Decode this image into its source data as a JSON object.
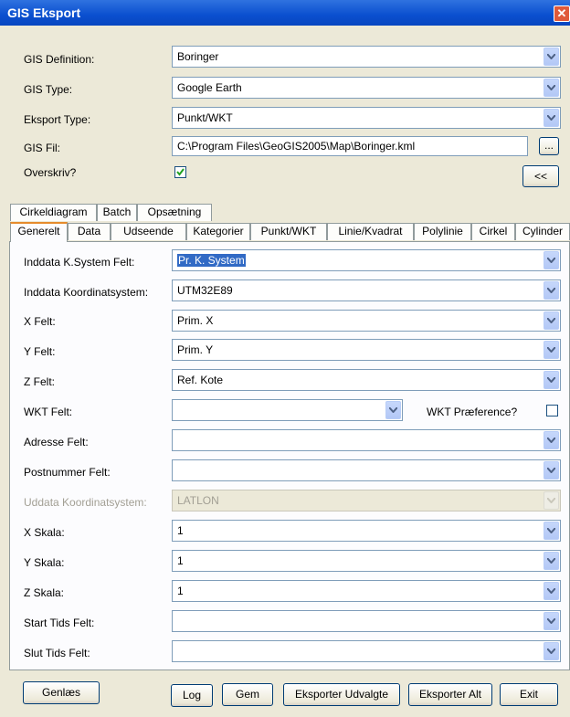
{
  "window": {
    "title": "GIS Eksport"
  },
  "top": {
    "definition_label": "GIS Definition:",
    "definition_value": "Boringer",
    "type_label": "GIS Type:",
    "type_value": "Google Earth",
    "export_type_label": "Eksport Type:",
    "export_type_value": "Punkt/WKT",
    "file_label": "GIS Fil:",
    "file_value": "C:\\Program Files\\GeoGIS2005\\Map\\Boringer.kml",
    "browse_label": "...",
    "overwrite_label": "Overskriv?",
    "overwrite_checked": true,
    "collapse_label": "<<"
  },
  "tabs_row1": [
    "Cirkeldiagram",
    "Batch",
    "Opsætning"
  ],
  "tabs_row2": [
    "Generelt",
    "Data",
    "Udseende",
    "Kategorier",
    "Punkt/WKT",
    "Linie/Kvadrat",
    "Polylinie",
    "Cirkel",
    "Cylinder"
  ],
  "fields": {
    "ks_label": "Inddata K.System Felt:",
    "ks_value": "Pr. K. System",
    "coord_label": "Inddata Koordinatsystem:",
    "coord_value": "UTM32E89",
    "x_label": "X Felt:",
    "x_value": "Prim. X",
    "y_label": "Y Felt:",
    "y_value": "Prim. Y",
    "z_label": "Z Felt:",
    "z_value": "Ref. Kote",
    "wkt_label": "WKT Felt:",
    "wkt_value": "",
    "wkt_pref_label": "WKT Præference?",
    "address_label": "Adresse Felt:",
    "address_value": "",
    "postal_label": "Postnummer Felt:",
    "postal_value": "",
    "out_coord_label": "Uddata Koordinatsystem:",
    "out_coord_value": "LATLON",
    "xscale_label": "X Skala:",
    "xscale_value": "1",
    "yscale_label": "Y Skala:",
    "yscale_value": "1",
    "zscale_label": "Z Skala:",
    "zscale_value": "1",
    "start_label": "Start Tids Felt:",
    "start_value": "",
    "end_label": "Slut Tids Felt:",
    "end_value": ""
  },
  "buttons": {
    "reload": "Genlæs",
    "log": "Log",
    "save": "Gem",
    "export_selected": "Eksporter Udvalgte",
    "export_all": "Eksporter Alt",
    "exit": "Exit"
  }
}
